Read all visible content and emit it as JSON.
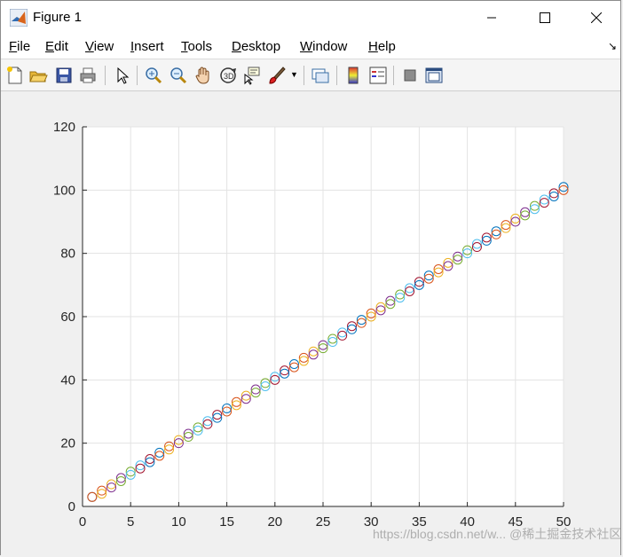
{
  "window": {
    "title": "Figure 1",
    "icon": "matlab-logo-icon"
  },
  "menubar": {
    "items": [
      {
        "label": "File",
        "ul": "F",
        "rest": "ile"
      },
      {
        "label": "Edit",
        "ul": "E",
        "rest": "dit"
      },
      {
        "label": "View",
        "ul": "V",
        "rest": "iew"
      },
      {
        "label": "Insert",
        "ul": "I",
        "rest": "nsert"
      },
      {
        "label": "Tools",
        "ul": "T",
        "rest": "ools"
      },
      {
        "label": "Desktop",
        "ul": "D",
        "rest": "esktop"
      },
      {
        "label": "Window",
        "ul": "W",
        "rest": "indow"
      },
      {
        "label": "Help",
        "ul": "H",
        "rest": "elp"
      }
    ]
  },
  "toolbar": {
    "icons": [
      "new-figure-icon",
      "open-file-icon",
      "save-icon",
      "print-icon",
      "edit-plot-pointer-icon",
      "zoom-in-icon",
      "zoom-out-icon",
      "pan-hand-icon",
      "rotate-3d-icon",
      "data-cursor-icon",
      "brush-icon",
      "link-plot-icon",
      "colorbar-icon",
      "legend-icon",
      "hide-plot-tools-icon",
      "show-plot-tools-icon"
    ]
  },
  "colors": {
    "marker_cycle": [
      "#0072BD",
      "#D95319",
      "#EDB120",
      "#7E2F8E",
      "#77AC30",
      "#4DBEEE",
      "#A2142F"
    ]
  },
  "watermark": "https://blog.csdn.net/w... @稀土掘金技术社区",
  "chart_data": {
    "type": "scatter",
    "title": "",
    "xlabel": "",
    "ylabel": "",
    "xlim": [
      0,
      50
    ],
    "ylim": [
      0,
      120
    ],
    "xticks": [
      0,
      5,
      10,
      15,
      20,
      25,
      30,
      35,
      40,
      45,
      50
    ],
    "yticks": [
      0,
      20,
      40,
      60,
      80,
      100,
      120
    ],
    "grid": true,
    "marker": "circle-open",
    "series": [
      {
        "x": [
          1,
          2,
          3,
          4,
          5,
          6,
          7,
          8,
          9,
          10,
          11,
          12,
          13,
          14,
          15,
          16,
          17,
          18,
          19,
          20,
          21,
          22,
          23,
          24,
          25,
          26,
          27,
          28,
          29,
          30,
          31,
          32,
          33,
          34,
          35,
          36,
          37,
          38,
          39,
          40,
          41,
          42,
          43,
          44,
          45,
          46,
          47,
          48,
          49,
          50
        ],
        "y": [
          3,
          5,
          7,
          9,
          11,
          13,
          15,
          17,
          19,
          21,
          23,
          25,
          27,
          29,
          31,
          33,
          35,
          37,
          39,
          41,
          43,
          45,
          47,
          49,
          51,
          53,
          55,
          57,
          59,
          61,
          63,
          65,
          67,
          69,
          71,
          73,
          75,
          77,
          79,
          81,
          83,
          85,
          87,
          89,
          91,
          93,
          95,
          97,
          99,
          101
        ]
      },
      {
        "x": [
          1,
          2,
          3,
          4,
          5,
          6,
          7,
          8,
          9,
          10,
          11,
          12,
          13,
          14,
          15,
          16,
          17,
          18,
          19,
          20,
          21,
          22,
          23,
          24,
          25,
          26,
          27,
          28,
          29,
          30,
          31,
          32,
          33,
          34,
          35,
          36,
          37,
          38,
          39,
          40,
          41,
          42,
          43,
          44,
          45,
          46,
          47,
          48,
          49,
          50
        ],
        "y": [
          3,
          4,
          6,
          8,
          10,
          12,
          14,
          16,
          18,
          20,
          22,
          24,
          26,
          28,
          30,
          32,
          34,
          36,
          38,
          40,
          42,
          44,
          46,
          48,
          50,
          52,
          54,
          56,
          58,
          60,
          62,
          64,
          66,
          68,
          70,
          72,
          74,
          76,
          78,
          80,
          82,
          84,
          86,
          88,
          90,
          92,
          94,
          96,
          98,
          100
        ]
      }
    ]
  }
}
